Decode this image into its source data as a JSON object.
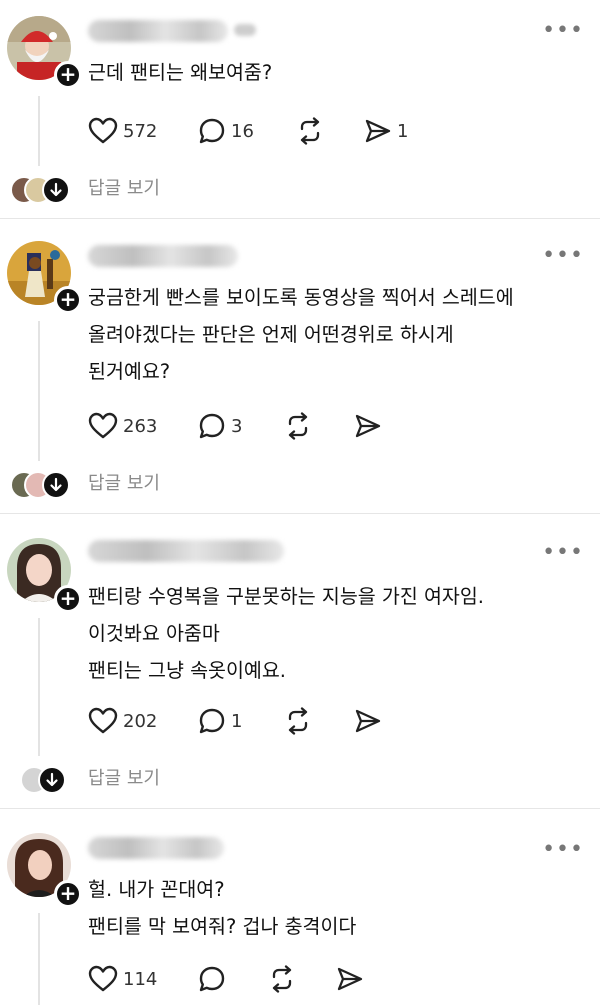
{
  "posts": [
    {
      "lines": [
        "근데 팬티는 왜보여줌?"
      ],
      "likes": "572",
      "comments": "16",
      "shares": "1",
      "reply_label": "답글 보기"
    },
    {
      "lines": [
        "궁금한게 빤스를 보이도록 동영상을 찍어서 스레드에",
        "올려야겠다는 판단은 언제 어떤경위로 하시게",
        "된거예요?"
      ],
      "likes": "263",
      "comments": "3",
      "shares": "",
      "reply_label": "답글 보기"
    },
    {
      "lines": [
        "팬티랑 수영복을 구분못하는 지능을 가진 여자임.",
        "이것봐요 아줌마",
        "팬티는 그냥 속옷이예요."
      ],
      "likes": "202",
      "comments": "1",
      "shares": "",
      "reply_label": "답글 보기"
    },
    {
      "lines": [
        "헐. 내가 꼰대여?",
        "팬티를 막 보여줘? 겁나 충격이다"
      ],
      "likes": "114",
      "comments": "",
      "shares": ""
    }
  ],
  "icons": {
    "like": "heart-icon",
    "comment": "comment-bubble-icon",
    "repost": "repost-icon",
    "share": "send-icon",
    "more": "more-horizontal-icon",
    "follow": "plus-icon",
    "expand": "arrow-down-icon"
  },
  "colors": {
    "text": "#111111",
    "muted": "#8a8a8a",
    "divider": "#e6e6e6",
    "icon": "#222222"
  }
}
